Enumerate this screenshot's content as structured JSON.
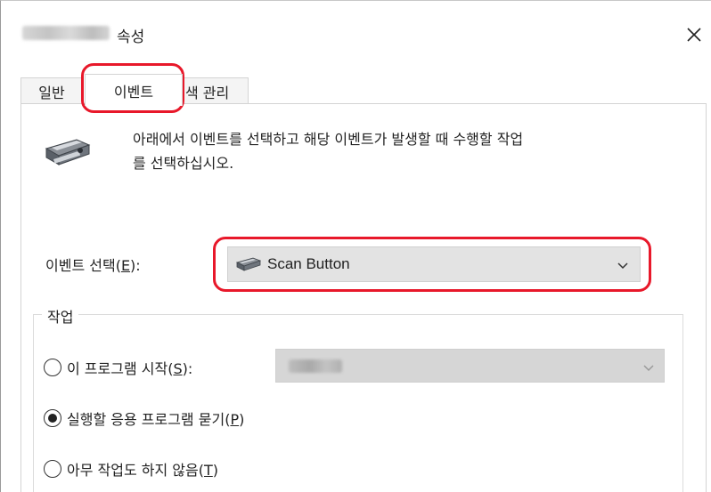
{
  "window": {
    "title_suffix": "속성",
    "close_glyph": "✕"
  },
  "tabs": [
    {
      "label": "일반",
      "selected": false
    },
    {
      "label": "이벤트",
      "selected": true
    },
    {
      "label": "색 관리",
      "selected": false
    }
  ],
  "description": {
    "line1": "아래에서 이벤트를 선택하고 해당 이벤트가 발생할 때 수행할 작업",
    "line2": "를 선택하십시오."
  },
  "event_select": {
    "label": "이벤트 선택",
    "mnemonic": "E",
    "value": "Scan Button",
    "icon": "scanner-icon"
  },
  "actions": {
    "group_label": "작업",
    "options": [
      {
        "label": "이 프로그램 시작",
        "mnemonic": "S",
        "selected": false
      },
      {
        "label": "실행할 응용 프로그램 묻기",
        "mnemonic": "P",
        "selected": true
      },
      {
        "label": "아무 작업도 하지 않음",
        "mnemonic": "T",
        "selected": false
      }
    ]
  },
  "colors": {
    "highlight": "#e8182a",
    "select_bg": "#e3e3e3",
    "disabled_select_bg": "#d6d6d6"
  }
}
